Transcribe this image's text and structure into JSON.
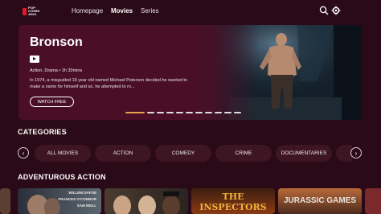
{
  "app": {
    "logo_text": "POP COMIN ASIA"
  },
  "nav": {
    "items": [
      "Homepage",
      "Movies",
      "Series"
    ],
    "active": "Movies"
  },
  "hero": {
    "title": "Bronson",
    "meta": "Action, Drama • 1h 33mins",
    "description": "In 1974, a misguided 19 year old named Michael Peterson decided he wanted to make a name for himself and so, he attempted to ro...",
    "cta": "WATCH FREE",
    "slides_total": 11,
    "active_slide": 1
  },
  "categories": {
    "title": "CATEGORIES",
    "items": [
      "ALL MOVIES",
      "ACTION",
      "COMEDY",
      "CRIME",
      "DOCUMENTARIES"
    ]
  },
  "adventurous": {
    "title": "ADVENTUROUS ACTION",
    "posters": [
      {
        "line1": "WILLEM DAFOE",
        "line2": "FRANCES O'CONNOR",
        "line3": "SAM NEILL"
      },
      {
        "line1": "",
        "line2": "",
        "line3": ""
      },
      {
        "line1": "THE INSPECTORS",
        "line2": "",
        "line3": ""
      },
      {
        "line1": "JURASSIC GAMES",
        "line2": "",
        "line3": ""
      }
    ]
  }
}
